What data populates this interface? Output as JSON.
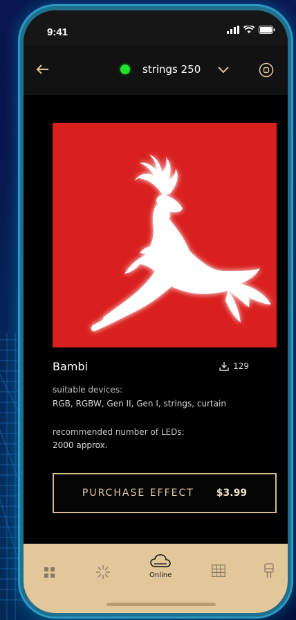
{
  "status_bar": {
    "time": "9:41"
  },
  "header": {
    "device_name": "strings 250",
    "device_status_color": "#1ee42a"
  },
  "effect": {
    "title": "Bambi",
    "downloads": "129",
    "image_icon": "leaping-deer-icon",
    "image_background": "#d9201e",
    "suitable_devices_label": "suitable devices:",
    "suitable_devices_value": "RGB, RGBW, Gen II, Gen I, strings, curtain",
    "recommended_leds_label": "recommended number of LEDs:",
    "recommended_leds_value": "2000 approx."
  },
  "purchase": {
    "label": "PURCHASE EFFECT",
    "price": "$3.99",
    "accent_color": "#d9bb8e"
  },
  "tabs": [
    {
      "icon": "grid-icon",
      "label": ""
    },
    {
      "icon": "sparkle-icon",
      "label": ""
    },
    {
      "icon": "cloud-icon",
      "label": "Online"
    },
    {
      "icon": "layout-grid-icon",
      "label": ""
    },
    {
      "icon": "device-icon",
      "label": ""
    }
  ]
}
